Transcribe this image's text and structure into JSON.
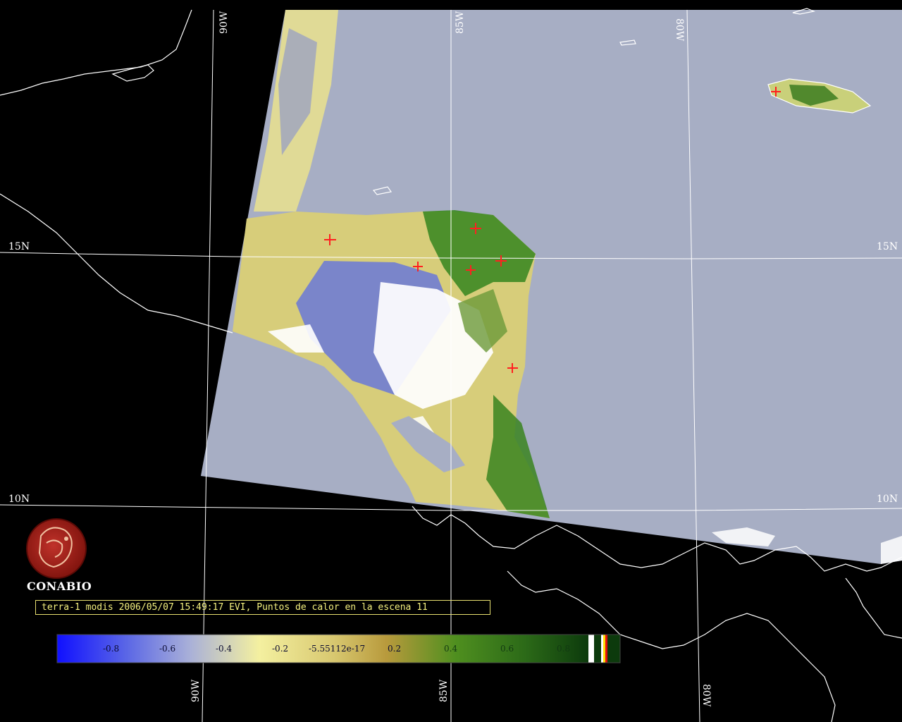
{
  "organization": {
    "name": "CONABIO",
    "logo_icon": "conabio-logo-icon"
  },
  "caption": {
    "text": "terra-1 modis 2006/05/07 15:49:17 EVI, Puntos de calor en la escena 11"
  },
  "grid_labels": {
    "top_90w": "90W",
    "top_85w": "85W",
    "top_80w": "80W",
    "left_15n": "15N",
    "right_15n": "15N",
    "left_10n": "10N",
    "right_10n": "10N",
    "bottom_90w": "90W",
    "bottom_85w": "85W",
    "bottom_80w": "80W"
  },
  "colorbar": {
    "labels": [
      "-0.8",
      "-0.6",
      "-0.4",
      "-0.2",
      "-5.55112e-17",
      "0.2",
      "0.4",
      "0.6",
      "0.8"
    ],
    "colors": [
      "#1010ff",
      "#a9b0d8",
      "#f4f0a0",
      "#c0a040",
      "#3a8a1a",
      "#0c3a0c"
    ]
  },
  "hotspot_marker": {
    "icon": "red-cross-icon",
    "color": "#ff2020"
  },
  "colors": {
    "background": "#000000",
    "ocean": "#a7aec4",
    "coastline": "#ffffff",
    "grid": "#ffffff",
    "caption_text": "#f3ef7e"
  }
}
